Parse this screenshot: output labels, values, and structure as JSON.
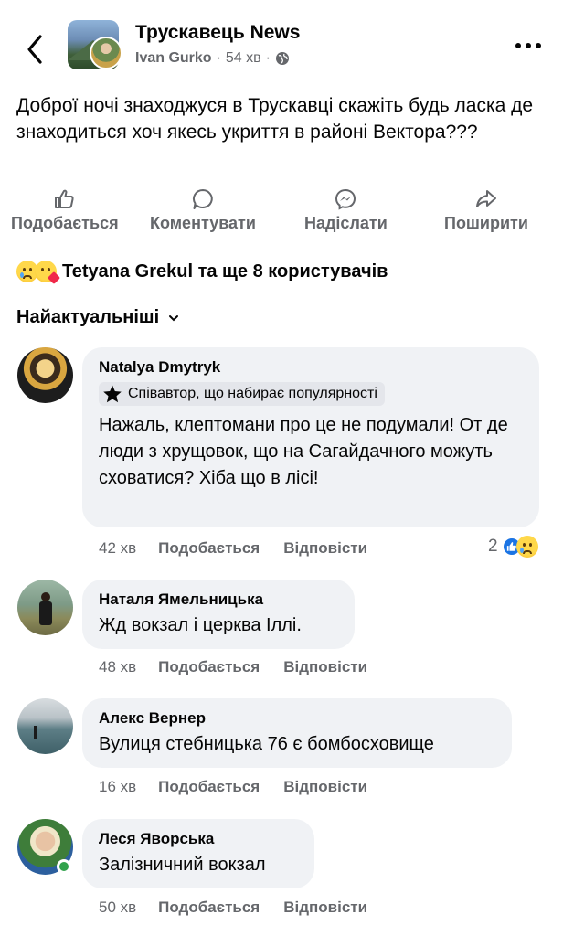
{
  "header": {
    "group_name": "Трускавець News",
    "author": "Ivan Gurko",
    "separator": "·",
    "time": "54 хв",
    "separator2": "·"
  },
  "post": {
    "text": "Доброї ночі знаходжуся в Трускавці  скажіть будь ласка де знаходиться хоч якесь укриття в районі Вектора???"
  },
  "actions": {
    "like": "Подобається",
    "comment": "Коментувати",
    "send": "Надіслати",
    "share": "Поширити"
  },
  "reactions": {
    "summary": "Tetyana Grekul та ще 8 користувачів"
  },
  "sort": {
    "label": "Найактуальніші"
  },
  "comments": [
    {
      "name": "Natalya Dmytryk",
      "badge": "Співавтор, що набирає популярності",
      "text": "Нажаль, клептомани про це не подумали! От де люди з хрущовок, що на Сагайдачного можуть сховатися? Хіба що в лісі!",
      "time": "42 хв",
      "like": "Подобається",
      "reply": "Відповісти",
      "reaction_count": "2"
    },
    {
      "name": "Наталя Ямельницька",
      "text": "Жд вокзал і церква Іллі.",
      "time": "48 хв",
      "like": "Подобається",
      "reply": "Відповісти"
    },
    {
      "name": "Алекс Вернер",
      "text": "Вулиця стебницька 76 є бомбосховище",
      "time": "16 хв",
      "like": "Подобається",
      "reply": "Відповісти"
    },
    {
      "name": "Леся Яворська",
      "text": "Залізничний вокзал",
      "time": "50 хв",
      "like": "Подобається",
      "reply": "Відповісти"
    }
  ],
  "colors": {
    "accent": "#1b74e4",
    "secondary_text": "#65676b",
    "bubble": "#f0f2f5",
    "online": "#31a24c"
  },
  "icons": [
    "back-arrow-icon",
    "globe-icon",
    "more-icon",
    "like-icon",
    "comment-icon",
    "messenger-icon",
    "share-icon",
    "chevron-down-icon",
    "star-badge-icon",
    "thumbs-up-reaction-icon",
    "sad-reaction-icon",
    "care-reaction-icon"
  ]
}
